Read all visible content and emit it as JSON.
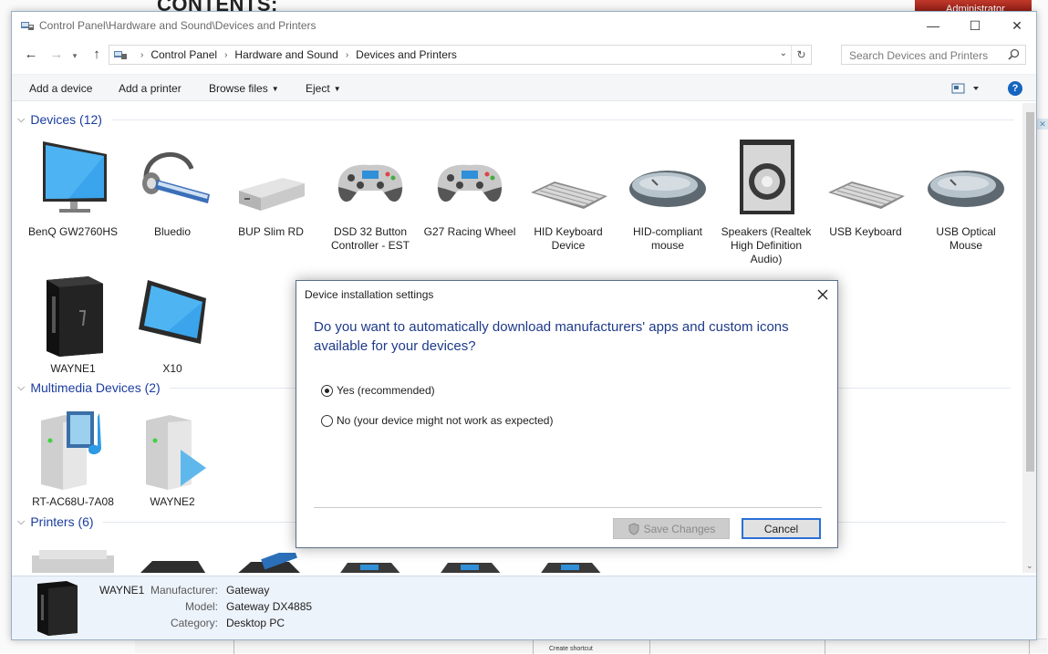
{
  "background": {
    "heading": "CONTENTS:",
    "admin_label": "Administrator",
    "footer_text": "Create shortcut"
  },
  "window": {
    "title": "Control Panel\\Hardware and Sound\\Devices and Printers",
    "controls": {
      "minimize": "—",
      "maximize": "☐",
      "close": "✕"
    }
  },
  "address": {
    "breadcrumbs": [
      "Control Panel",
      "Hardware and Sound",
      "Devices and Printers"
    ],
    "search_placeholder": "Search Devices and Printers"
  },
  "toolbar": {
    "add_device": "Add a device",
    "add_printer": "Add a printer",
    "browse_files": "Browse files",
    "eject": "Eject",
    "help": "?"
  },
  "groups": {
    "devices": {
      "label": "Devices (12)"
    },
    "multimedia": {
      "label": "Multimedia Devices (2)"
    },
    "printers": {
      "label": "Printers (6)"
    }
  },
  "devices": [
    {
      "name": "BenQ GW2760HS",
      "icon": "monitor-icon"
    },
    {
      "name": "Bluedio",
      "icon": "headset-icon"
    },
    {
      "name": "BUP Slim RD",
      "icon": "drive-icon"
    },
    {
      "name": "DSD 32 Button Controller - EST",
      "icon": "gamepad-icon"
    },
    {
      "name": "G27 Racing Wheel",
      "icon": "gamepad-icon"
    },
    {
      "name": "HID Keyboard Device",
      "icon": "keyboard-icon"
    },
    {
      "name": "HID-compliant mouse",
      "icon": "mouse-icon"
    },
    {
      "name": "Speakers (Realtek High Definition Audio)",
      "icon": "speaker-icon"
    },
    {
      "name": "USB Keyboard",
      "icon": "keyboard-icon"
    },
    {
      "name": "USB Optical Mouse",
      "icon": "mouse-icon"
    },
    {
      "name": "WAYNE1",
      "icon": "pc-tower-icon"
    },
    {
      "name": "X10",
      "icon": "tablet-icon"
    }
  ],
  "multimedia": [
    {
      "name": "RT-AC68U-7A08",
      "icon": "media-server-icon"
    },
    {
      "name": "WAYNE2",
      "icon": "media-player-icon"
    }
  ],
  "details": {
    "name": "WAYNE1",
    "manufacturer_label": "Manufacturer:",
    "manufacturer": "Gateway",
    "model_label": "Model:",
    "model": "Gateway DX4885",
    "category_label": "Category:",
    "category": "Desktop PC"
  },
  "dialog": {
    "title": "Device installation settings",
    "question": "Do you want to automatically download manufacturers' apps and custom icons available for your devices?",
    "option_yes": "Yes (recommended)",
    "option_no": "No (your device might not work as expected)",
    "selected": "yes",
    "save_label": "Save Changes",
    "cancel_label": "Cancel"
  },
  "colors": {
    "accent": "#1a3d9e",
    "selection": "#d7d7d7",
    "details_bg": "#edf3fb",
    "focus": "#2a6fd6"
  }
}
